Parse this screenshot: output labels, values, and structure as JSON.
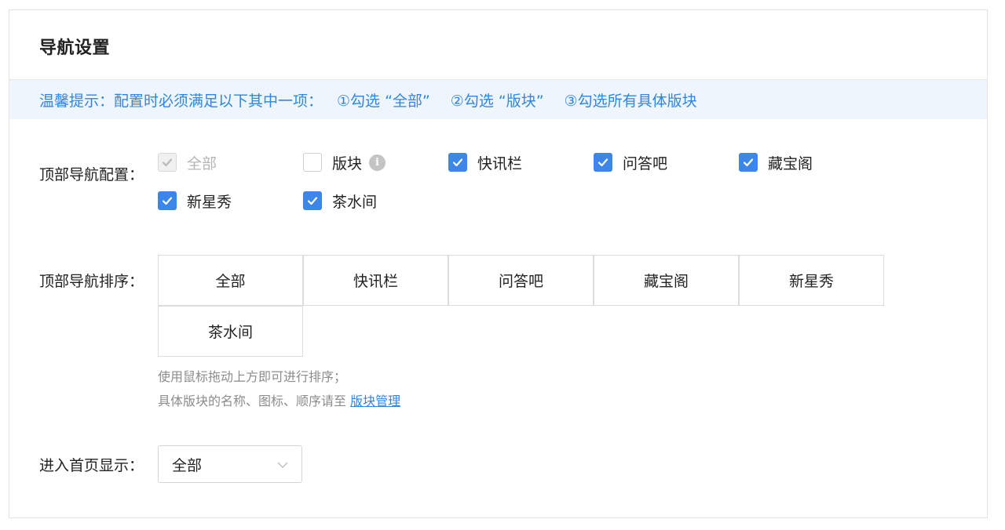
{
  "header": {
    "title": "导航设置"
  },
  "tip": {
    "prefix": "温馨提示：配置时必须满足以下其中一项：",
    "items": [
      "①勾选 “全部”",
      "②勾选 “版块”",
      "③勾选所有具体版块"
    ]
  },
  "nav_config": {
    "label": "顶部导航配置：",
    "options": [
      {
        "label": "全部",
        "checked": true,
        "disabled": true
      },
      {
        "label": "版块",
        "checked": false,
        "disabled": false,
        "info_icon": "info-icon"
      },
      {
        "label": "快讯栏",
        "checked": true,
        "disabled": false
      },
      {
        "label": "问答吧",
        "checked": true,
        "disabled": false
      },
      {
        "label": "藏宝阁",
        "checked": true,
        "disabled": false
      },
      {
        "label": "新星秀",
        "checked": true,
        "disabled": false
      },
      {
        "label": "茶水间",
        "checked": true,
        "disabled": false
      }
    ]
  },
  "nav_sort": {
    "label": "顶部导航排序：",
    "items": [
      "全部",
      "快讯栏",
      "问答吧",
      "藏宝阁",
      "新星秀",
      "茶水间"
    ],
    "hint_line1": "使用鼠标拖动上方即可进行排序；",
    "hint_line2_prefix": "具体版块的名称、图标、顺序请至 ",
    "hint_link": "版块管理"
  },
  "home_display": {
    "label": "进入首页显示：",
    "selected": "全部",
    "icon": "chevron-down-icon"
  },
  "colors": {
    "accent": "#3b86e8",
    "tip_bg": "#eef5fc",
    "tip_text": "#2f86e6"
  }
}
